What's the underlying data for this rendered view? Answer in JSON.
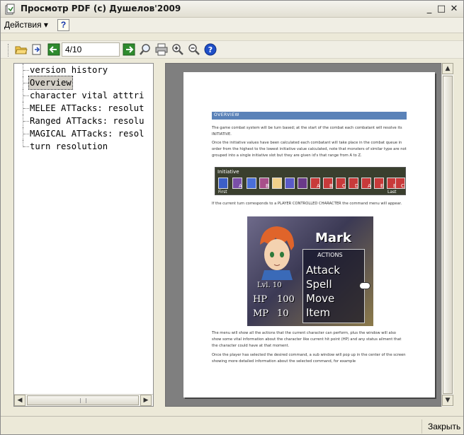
{
  "window": {
    "title": "Просмотр PDF (c) Душелов'2009",
    "controls": {
      "minimize": "_",
      "maximize": "□",
      "close": "✕"
    }
  },
  "menubar": {
    "actions_label": "Действия",
    "actions_arrow": "▾",
    "help_label": "?"
  },
  "toolbar": {
    "page_value": "4/10",
    "icons": [
      "open-folder-icon",
      "export-icon",
      "prev-page-icon",
      "next-page-icon",
      "find-icon",
      "print-icon",
      "zoom-in-icon",
      "zoom-out-icon",
      "help-icon"
    ],
    "colors": {
      "nav_arrow": "#2E8B2E",
      "help": "#1F4FC8"
    }
  },
  "outline": {
    "items": [
      {
        "label": "version history",
        "selected": false
      },
      {
        "label": "Overview",
        "selected": true
      },
      {
        "label": "character vital atttri",
        "selected": false
      },
      {
        "label": "MELEE ATTacks: resolut",
        "selected": false
      },
      {
        "label": "Ranged ATTacks: resolu",
        "selected": false
      },
      {
        "label": "MAGICAL ATTacks: resol",
        "selected": false
      },
      {
        "label": "turn resolution",
        "selected": false
      }
    ]
  },
  "pdf_page": {
    "heading": "OVERVIEW",
    "heading_color": "#5A82B8",
    "para1": "The game combat system will be turn based; at the start of the combat each combatant will resolve its INITIATIVE.",
    "para2": "Once the initiative values have been calculated each combatant will take place in the combat queue in order from the highest to the lowest initiative value calculated, note that monsters of similar type are not grouped into a single initiative slot but they are given id's that range from A to Z.",
    "initiative_label": "Initiative",
    "initiative_first": "First",
    "initiative_last": "Last",
    "initiative_letters": [
      "A",
      "B",
      "A",
      "B",
      "C",
      "D",
      "A",
      "E",
      "B",
      "C"
    ],
    "para3": "If the current turn corresponds to a PLAYER CONTROLLED CHARACTER the command menu will appear.",
    "battle": {
      "name": "Mark",
      "actions_title": "ACTIONS",
      "commands": [
        "Attack",
        "Spell",
        "Move",
        "Item"
      ],
      "level": "Lvl. 10",
      "hp_label": "HP",
      "hp_value": "100",
      "mp_label": "MP",
      "mp_value": "10"
    },
    "para4": "The menu will show all the actions that the current character can perform, plus the window will also show some vital information about the character like current hit point (HP) and any status ailment that the character could have at that moment.",
    "para5": "Once the player has selected the desired command, a sub window will pop up in the center of the screen showing more detailed information about the selected command, for example"
  },
  "statusbar": {
    "close_label": "Закрыть"
  }
}
